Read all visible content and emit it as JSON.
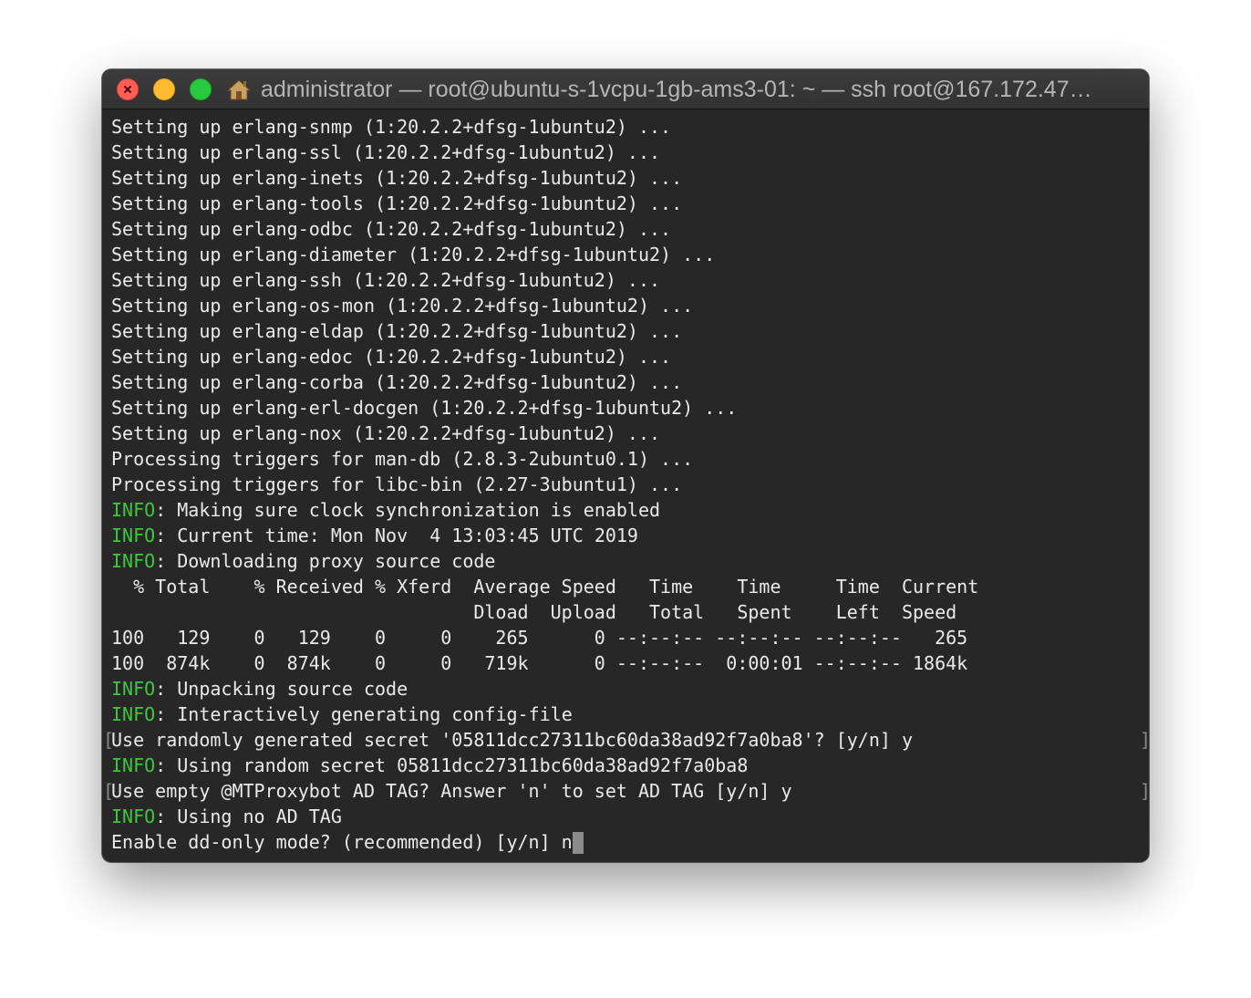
{
  "window": {
    "title": "administrator — root@ubuntu-s-1vcpu-1gb-ams3-01: ~ — ssh root@167.172.47…"
  },
  "colors": {
    "info": "#3ec73e",
    "text": "#eaeaea",
    "background": "#272727",
    "close": "#fe5f57",
    "minimize": "#febc2e",
    "zoom": "#28c840"
  },
  "icons": {
    "titlebar": "home-icon"
  },
  "terminal": {
    "lines": [
      {
        "text": "Setting up erlang-snmp (1:20.2.2+dfsg-1ubuntu2) ..."
      },
      {
        "text": "Setting up erlang-ssl (1:20.2.2+dfsg-1ubuntu2) ..."
      },
      {
        "text": "Setting up erlang-inets (1:20.2.2+dfsg-1ubuntu2) ..."
      },
      {
        "text": "Setting up erlang-tools (1:20.2.2+dfsg-1ubuntu2) ..."
      },
      {
        "text": "Setting up erlang-odbc (1:20.2.2+dfsg-1ubuntu2) ..."
      },
      {
        "text": "Setting up erlang-diameter (1:20.2.2+dfsg-1ubuntu2) ..."
      },
      {
        "text": "Setting up erlang-ssh (1:20.2.2+dfsg-1ubuntu2) ..."
      },
      {
        "text": "Setting up erlang-os-mon (1:20.2.2+dfsg-1ubuntu2) ..."
      },
      {
        "text": "Setting up erlang-eldap (1:20.2.2+dfsg-1ubuntu2) ..."
      },
      {
        "text": "Setting up erlang-edoc (1:20.2.2+dfsg-1ubuntu2) ..."
      },
      {
        "text": "Setting up erlang-corba (1:20.2.2+dfsg-1ubuntu2) ..."
      },
      {
        "text": "Setting up erlang-erl-docgen (1:20.2.2+dfsg-1ubuntu2) ..."
      },
      {
        "text": "Setting up erlang-nox (1:20.2.2+dfsg-1ubuntu2) ..."
      },
      {
        "text": "Processing triggers for man-db (2.8.3-2ubuntu0.1) ..."
      },
      {
        "text": "Processing triggers for libc-bin (2.27-3ubuntu1) ..."
      },
      {
        "tag": "INFO",
        "text": ": Making sure clock synchronization is enabled"
      },
      {
        "tag": "INFO",
        "text": ": Current time: Mon Nov  4 13:03:45 UTC 2019"
      },
      {
        "tag": "INFO",
        "text": ": Downloading proxy source code"
      },
      {
        "text": "  % Total    % Received % Xferd  Average Speed   Time    Time     Time  Current"
      },
      {
        "text": "                                 Dload  Upload   Total   Spent    Left  Speed"
      },
      {
        "text": "100   129    0   129    0     0    265      0 --:--:-- --:--:-- --:--:--   265"
      },
      {
        "text": "100  874k    0  874k    0     0   719k      0 --:--:--  0:00:01 --:--:-- 1864k"
      },
      {
        "tag": "INFO",
        "text": ": Unpacking source code"
      },
      {
        "tag": "INFO",
        "text": ": Interactively generating config-file"
      },
      {
        "text": "Use randomly generated secret '05811dcc27311bc60da38ad92f7a0ba8'? [y/n] y",
        "bracketed": true
      },
      {
        "tag": "INFO",
        "text": ": Using random secret 05811dcc27311bc60da38ad92f7a0ba8"
      },
      {
        "text": "Use empty @MTProxybot AD TAG? Answer 'n' to set AD TAG [y/n] y",
        "bracketed": true
      },
      {
        "tag": "INFO",
        "text": ": Using no AD TAG"
      },
      {
        "text": "Enable dd-only mode? (recommended) [y/n] n",
        "cursor": true
      }
    ]
  },
  "bracket": {
    "open": "[",
    "close": "]"
  }
}
